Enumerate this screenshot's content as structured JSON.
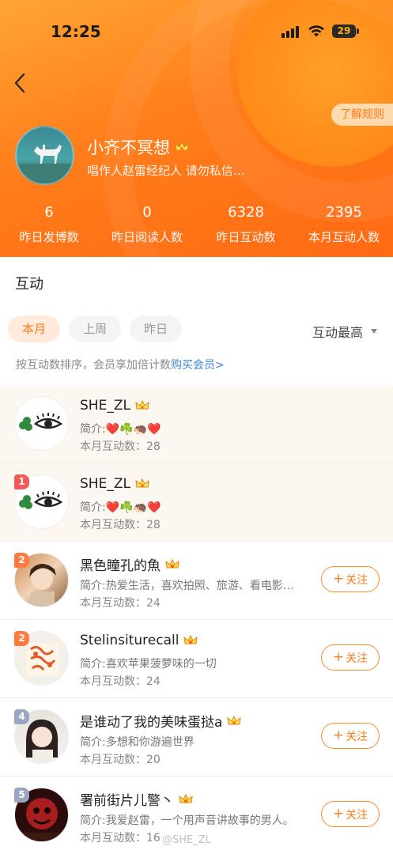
{
  "status_bar": {
    "time": "12:25",
    "battery": "29"
  },
  "header": {
    "rules_label": "了解规则",
    "profile": {
      "name": "小齐不冥想",
      "bio": "唱作人赵雷经纪人 请勿私信…"
    },
    "stats": [
      {
        "value": "6",
        "label": "昨日发博数"
      },
      {
        "value": "0",
        "label": "昨日阅读人数"
      },
      {
        "value": "6328",
        "label": "昨日互动数"
      },
      {
        "value": "2395",
        "label": "本月互动人数"
      }
    ]
  },
  "interaction": {
    "title": "互动",
    "tabs": [
      {
        "label": "本月"
      },
      {
        "label": "上周"
      },
      {
        "label": "昨日"
      }
    ],
    "sort_label": "互动最高",
    "hint_text": "按互动数排序，会员享加倍计数",
    "hint_link": "购买会员>"
  },
  "list": [
    {
      "rank": "",
      "name": "SHE_ZL",
      "intro": "简介:❤️☘️🦔❤️",
      "count": "本月互动数：28",
      "follow": ""
    },
    {
      "rank": "1",
      "name": "SHE_ZL",
      "intro": "简介:❤️☘️🦔❤️",
      "count": "本月互动数：28",
      "follow": ""
    },
    {
      "rank": "2",
      "name": "黑色瞳孔的魚",
      "intro": "简介:热爱生活，喜欢拍照、旅游、看电影…",
      "count": "本月互动数：24",
      "follow": "关注"
    },
    {
      "rank": "2",
      "name": "Stelinsiturecall",
      "intro": "简介:喜欢苹果菠萝味的一切",
      "count": "本月互动数：24",
      "follow": "关注"
    },
    {
      "rank": "4",
      "name": "是谁动了我的美味蛋挞a",
      "intro": "简介:多想和你游遍世界",
      "count": "本月互动数：20",
      "follow": "关注"
    },
    {
      "rank": "5",
      "name": "署前街片儿警丶",
      "intro": "简介:我爱赵雷，一个用声音讲故事的男人。",
      "count": "本月互动数：16",
      "follow": "关注"
    }
  ],
  "watermark": "@SHE_ZL"
}
